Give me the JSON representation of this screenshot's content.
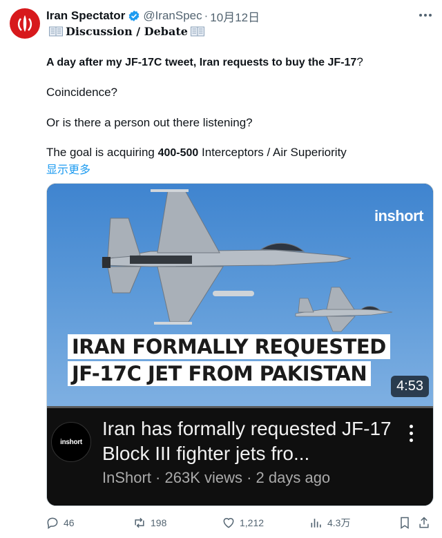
{
  "author": {
    "name": "Iran Spectator",
    "handle": "@IranSpec",
    "separator": "·",
    "date": "10月12日"
  },
  "subtitle": "Discussion / Debate",
  "tweet": {
    "line1_bold": "A day after my JF-17C tweet, Iran requests to buy the JF-17",
    "line1_end": "?",
    "line2": "Coincidence?",
    "line3": "Or is there a person out there listening?",
    "line4_pre": "The goal is acquiring ",
    "line4_bold": "400-500",
    "line4_post": "  Interceptors / Air Superiority",
    "show_more": "显示更多"
  },
  "media": {
    "brand": "inshort",
    "headline_1": "IRAN FORMALLY REQUESTED",
    "headline_2": "JF-17C JET FROM PAKISTAN",
    "duration": "4:53",
    "channel_logo": "inshort",
    "video_title": "Iran has formally requested JF-17 Block III fighter jets fro...",
    "video_meta": "InShort · 263K views · 2 days ago"
  },
  "actions": {
    "replies": "46",
    "reposts": "198",
    "likes": "1,212",
    "views": "4.3万"
  },
  "colors": {
    "verified": "#1d9bf0",
    "avatar": "#d7191c",
    "link": "#1d9bf0"
  },
  "icons": [
    "verified-badge-icon",
    "more-icon",
    "book-icon",
    "reply-icon",
    "repost-icon",
    "like-icon",
    "views-icon",
    "bookmark-icon"
  ]
}
